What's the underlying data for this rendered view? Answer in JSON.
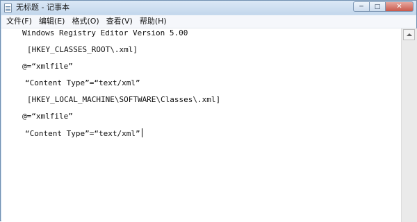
{
  "window": {
    "title": "无标题 - 记事本",
    "controls": {
      "minimize": "─",
      "maximize": "□",
      "close": "✕"
    }
  },
  "menu": {
    "items": [
      "文件(F)",
      "编辑(E)",
      "格式(O)",
      "查看(V)",
      "帮助(H)"
    ]
  },
  "editor": {
    "lines": [
      "Windows Registry Editor Version 5.00",
      "[HKEY_CLASSES_ROOT\\.xml]",
      "@=“xmlfile”",
      "“Content Type”=“text/xml”",
      "[HKEY_LOCAL_MACHINE\\SOFTWARE\\Classes\\.xml]",
      "@=“xmlfile”",
      "“Content Type”=“text/xml”"
    ]
  },
  "icons": {
    "app": "notepad-icon",
    "scroll_up": "scroll-up-arrow-icon"
  },
  "colors": {
    "titlebar": "#c3d7ec",
    "close_button": "#c9594b",
    "editor_background": "#ffffff"
  }
}
